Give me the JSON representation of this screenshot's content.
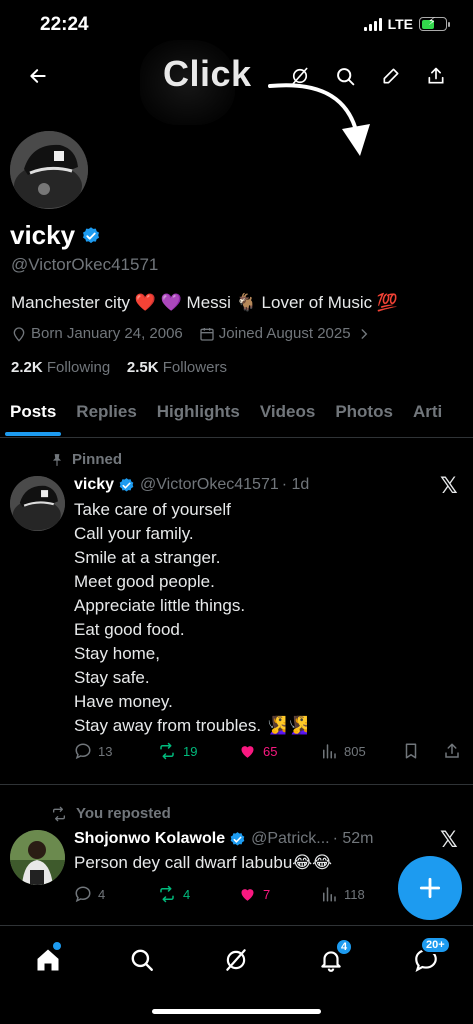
{
  "status_bar": {
    "time": "22:24",
    "network": "LTE"
  },
  "annotation": {
    "label": "Click"
  },
  "profile": {
    "name": "vicky",
    "handle": "@VictorOkec41571",
    "bio": "Manchester city ❤️ 💜 Messi 🐐 Lover of Music 💯",
    "born": "Born January 24, 2006",
    "joined": "Joined August 2025",
    "following_count": "2.2K",
    "following_label": "Following",
    "followers_count": "2.5K",
    "followers_label": "Followers"
  },
  "tabs": [
    "Posts",
    "Replies",
    "Highlights",
    "Videos",
    "Photos",
    "Arti"
  ],
  "pinned_post": {
    "label": "Pinned",
    "author": "vicky",
    "handle": "@VictorOkec41571",
    "time": "· 1d",
    "lines": [
      "Take care of yourself",
      "Call your family.",
      "Smile at a stranger.",
      "Meet good people.",
      "Appreciate little things.",
      "Eat good food.",
      "Stay home,",
      "Stay safe.",
      "Have money.",
      "Stay away from troubles. 🧏‍♀️🧏‍♀️"
    ],
    "replies": "13",
    "reposts": "19",
    "likes": "65",
    "views": "805"
  },
  "repost": {
    "label": "You reposted",
    "author": "Shojonwo Kolawole",
    "handle": "@Patrick...",
    "time": "· 52m",
    "text": "Person dey call dwarf labubu😂😂",
    "replies": "4",
    "reposts": "4",
    "likes": "7",
    "views": "118"
  },
  "bottom_nav": {
    "notifications_badge": "4",
    "messages_badge": "20+"
  },
  "colors": {
    "accent": "#1d9bf0",
    "repost_green": "#00ba7c",
    "like_pink": "#f91880",
    "muted": "#71767b"
  }
}
